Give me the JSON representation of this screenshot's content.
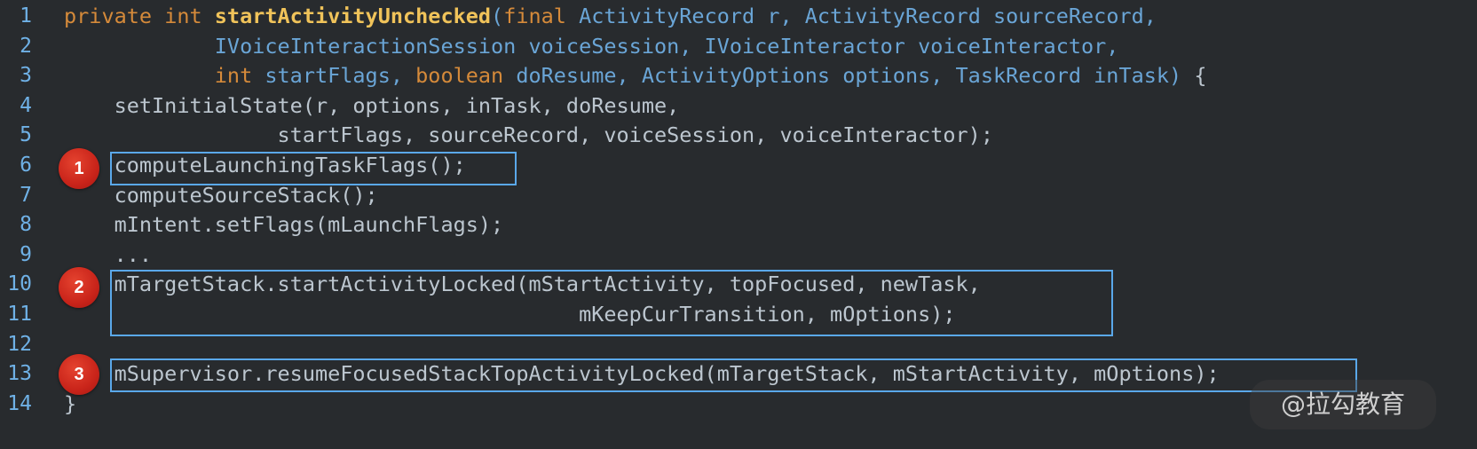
{
  "editor": {
    "lines": [
      {
        "num": "1",
        "tokens": [
          {
            "t": "private ",
            "c": "kw"
          },
          {
            "t": "int ",
            "c": "kw"
          },
          {
            "t": "startActivityUnchecked",
            "c": "fn"
          },
          {
            "t": "(",
            "c": "ty"
          },
          {
            "t": "final ",
            "c": "kw"
          },
          {
            "t": "ActivityRecord r, ActivityRecord sourceRecord,",
            "c": "ty"
          }
        ]
      },
      {
        "num": "2",
        "tokens": [
          {
            "t": "            IVoiceInteractionSession voiceSession, IVoiceInteractor voiceInteractor,",
            "c": "ty"
          }
        ]
      },
      {
        "num": "3",
        "tokens": [
          {
            "t": "            ",
            "c": "ty"
          },
          {
            "t": "int ",
            "c": "kw"
          },
          {
            "t": "startFlags, ",
            "c": "ty"
          },
          {
            "t": "boolean ",
            "c": "kw"
          },
          {
            "t": "doResume, ActivityOptions options, TaskRecord inTask) ",
            "c": "ty"
          },
          {
            "t": "{",
            "c": "pl"
          }
        ]
      },
      {
        "num": "4",
        "tokens": [
          {
            "t": "    setInitialState(r, options, inTask, doResume,",
            "c": "pl"
          }
        ]
      },
      {
        "num": "5",
        "tokens": [
          {
            "t": "                 startFlags, sourceRecord, voiceSession, voiceInteractor);",
            "c": "pl"
          }
        ]
      },
      {
        "num": "6",
        "tokens": [
          {
            "t": "    computeLaunchingTaskFlags();",
            "c": "pl"
          }
        ]
      },
      {
        "num": "7",
        "tokens": [
          {
            "t": "    computeSourceStack();",
            "c": "pl"
          }
        ]
      },
      {
        "num": "8",
        "tokens": [
          {
            "t": "    mIntent.setFlags(mLaunchFlags);",
            "c": "pl"
          }
        ]
      },
      {
        "num": "9",
        "tokens": [
          {
            "t": "    ...",
            "c": "pl"
          }
        ]
      },
      {
        "num": "10",
        "tokens": [
          {
            "t": "    mTargetStack.startActivityLocked(mStartActivity, topFocused, newTask,",
            "c": "pl"
          }
        ]
      },
      {
        "num": "11",
        "tokens": [
          {
            "t": "                                         mKeepCurTransition, mOptions);",
            "c": "pl"
          }
        ]
      },
      {
        "num": "12",
        "tokens": []
      },
      {
        "num": "13",
        "tokens": [
          {
            "t": "    mSupervisor.resumeFocusedStackTopActivityLocked(mTargetStack, mStartActivity, mOptions);",
            "c": "pl"
          }
        ]
      },
      {
        "num": "14",
        "tokens": [
          {
            "t": "}",
            "c": "pl"
          }
        ]
      }
    ]
  },
  "annotations": {
    "badge1": "1",
    "badge2": "2",
    "badge3": "3"
  },
  "watermark": "@拉勾教育",
  "colors": {
    "background": "#282b2e",
    "keyword": "#d58a3a",
    "function": "#f0c35a",
    "type": "#6aa5d6",
    "plain": "#bcc6cf",
    "highlight_box": "#5aa8ea",
    "badge": "#c9241a"
  }
}
